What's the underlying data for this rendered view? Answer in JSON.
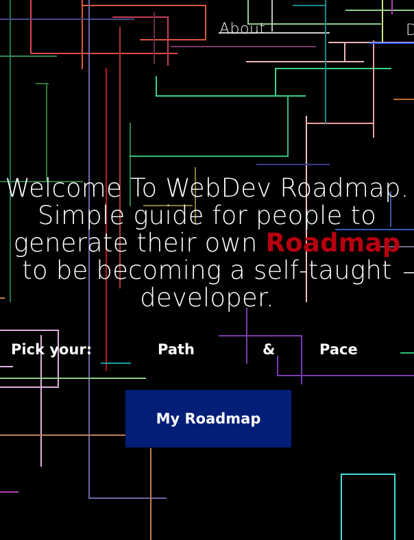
{
  "nav": {
    "about_label": "About",
    "clipped_label": "D"
  },
  "hero": {
    "title_line_a": "Welcome To WebDev Roadmap. Simple guide for people to generate their own",
    "title_accent": "Roadmap",
    "title_line_b": "to be becoming a self-taught developer."
  },
  "picker": {
    "prefix_label": "Pick your:",
    "path_label": "Path",
    "joiner": "&",
    "pace_label": "Pace"
  },
  "cta": {
    "label": "My Roadmap"
  },
  "colors": {
    "background": "#000000",
    "accent": "#b8000f",
    "button": "#021e76"
  }
}
